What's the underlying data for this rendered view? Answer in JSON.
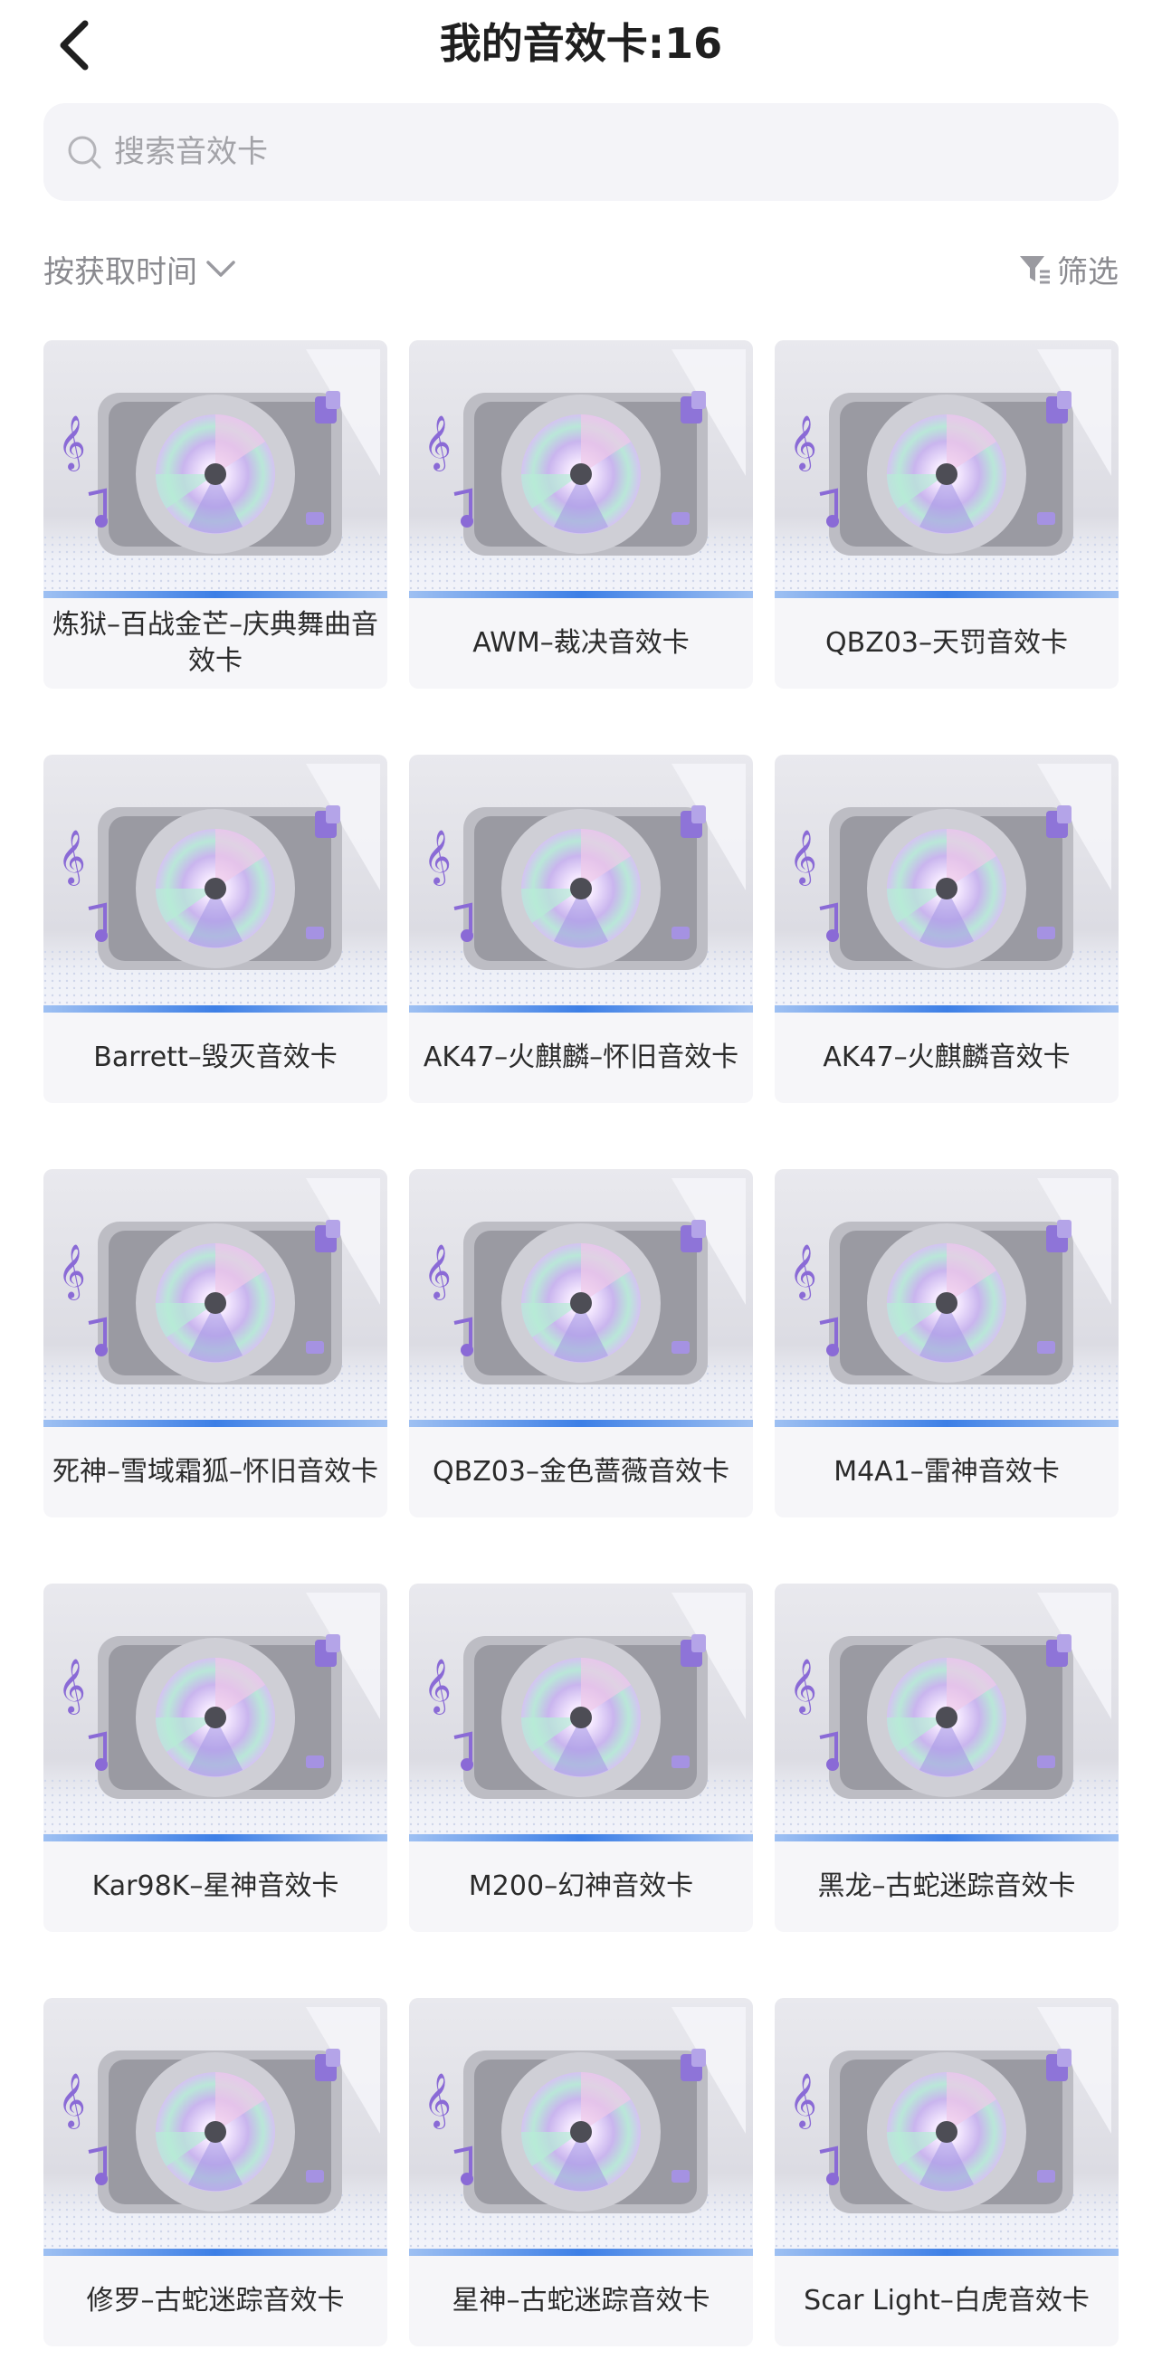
{
  "header": {
    "title": "我的音效卡:16"
  },
  "search": {
    "placeholder": "搜索音效卡"
  },
  "toolbar": {
    "sort_label": "按获取时间",
    "filter_label": "筛选"
  },
  "cards": [
    {
      "label": "炼狱–百战金芒–庆典舞曲音效卡"
    },
    {
      "label": "AWM–裁决音效卡"
    },
    {
      "label": "QBZ03–天罚音效卡"
    },
    {
      "label": "Barrett–毁灭音效卡"
    },
    {
      "label": "AK47–火麒麟–怀旧音效卡"
    },
    {
      "label": "AK47–火麒麟音效卡"
    },
    {
      "label": "死神–雪域霜狐–怀旧音效卡"
    },
    {
      "label": "QBZ03–金色蔷薇音效卡"
    },
    {
      "label": "M4A1–雷神音效卡"
    },
    {
      "label": "Kar98K–星神音效卡"
    },
    {
      "label": "M200–幻神音效卡"
    },
    {
      "label": "黑龙–古蛇迷踪音效卡"
    },
    {
      "label": "修罗–古蛇迷踪音效卡"
    },
    {
      "label": "星神–古蛇迷踪音效卡"
    },
    {
      "label": "Scar Light–白虎音效卡"
    }
  ]
}
